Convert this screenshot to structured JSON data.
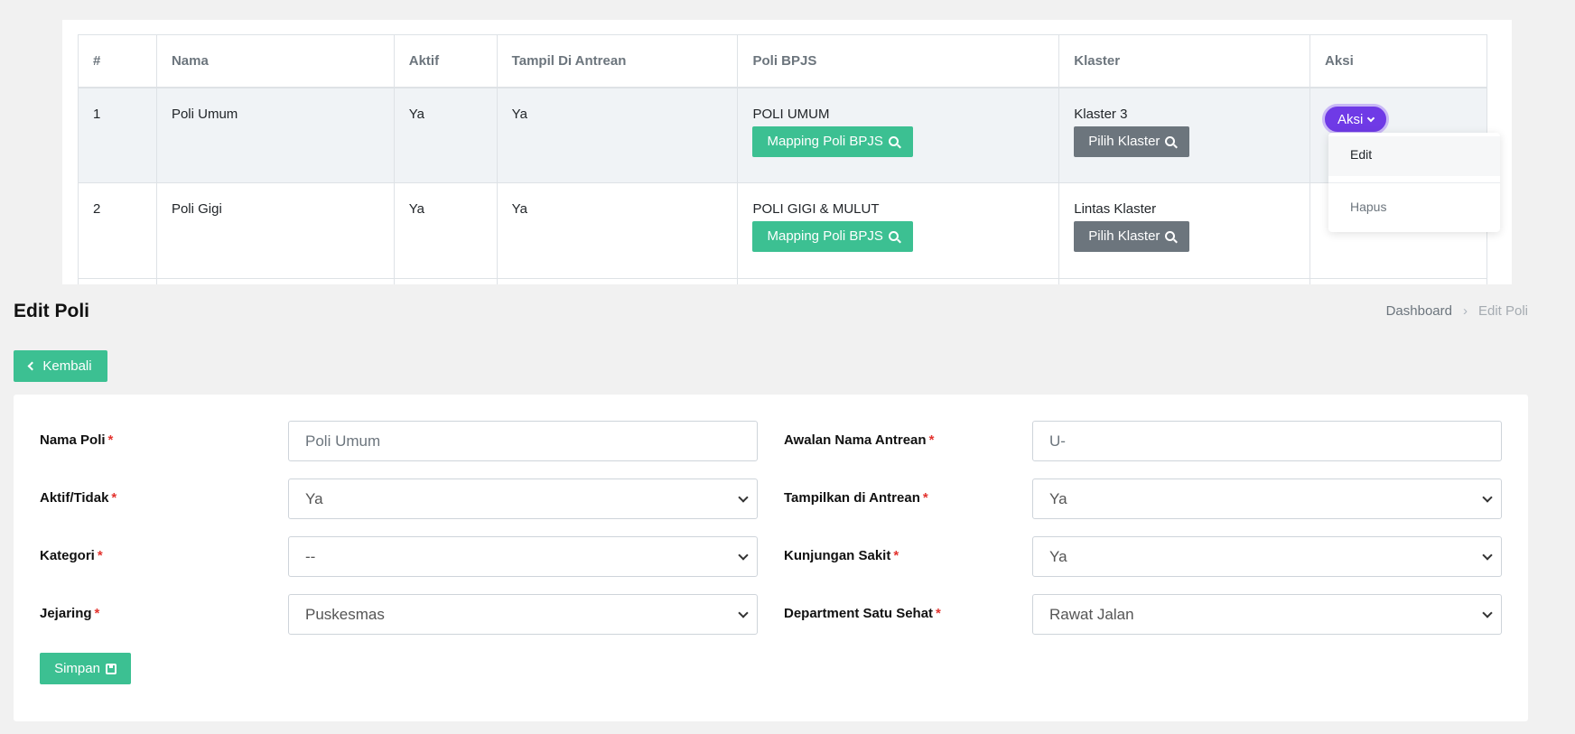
{
  "table": {
    "headers": [
      "#",
      "Nama",
      "Aktif",
      "Tampil Di Antrean",
      "Poli BPJS",
      "Klaster",
      "Aksi"
    ],
    "rows": [
      {
        "no": "1",
        "nama": "Poli Umum",
        "aktif": "Ya",
        "tampil": "Ya",
        "poli_bpjs": "POLI UMUM",
        "klaster": "Klaster 3"
      },
      {
        "no": "2",
        "nama": "Poli Gigi",
        "aktif": "Ya",
        "tampil": "Ya",
        "poli_bpjs": "POLI GIGI & MULUT",
        "klaster": "Lintas Klaster"
      }
    ],
    "mapping_button": "Mapping Poli BPJS",
    "klaster_button": "Pilih Klaster",
    "aksi_button": "Aksi",
    "aksi_menu": {
      "edit": "Edit",
      "hapus": "Hapus"
    }
  },
  "page": {
    "title": "Edit Poli",
    "breadcrumb": {
      "home": "Dashboard",
      "current": "Edit Poli"
    },
    "back_button": "Kembali"
  },
  "form": {
    "nama_poli": {
      "label": "Nama Poli",
      "value": "Poli Umum"
    },
    "awalan": {
      "label": "Awalan Nama Antrean",
      "value": "U-"
    },
    "aktif": {
      "label": "Aktif/Tidak",
      "value": "Ya"
    },
    "tampilkan": {
      "label": "Tampilkan di Antrean",
      "value": "Ya"
    },
    "kategori": {
      "label": "Kategori",
      "value": "--"
    },
    "kunjungan": {
      "label": "Kunjungan Sakit",
      "value": "Ya"
    },
    "jejaring": {
      "label": "Jejaring",
      "value": "Puskesmas"
    },
    "department": {
      "label": "Department Satu Sehat",
      "value": "Rawat Jalan"
    },
    "required_mark": "*",
    "save_button": "Simpan"
  },
  "colors": {
    "primary": "#3cc092",
    "secondary": "#6c757d",
    "accent": "#6f3ae6",
    "required": "#e3342f"
  }
}
